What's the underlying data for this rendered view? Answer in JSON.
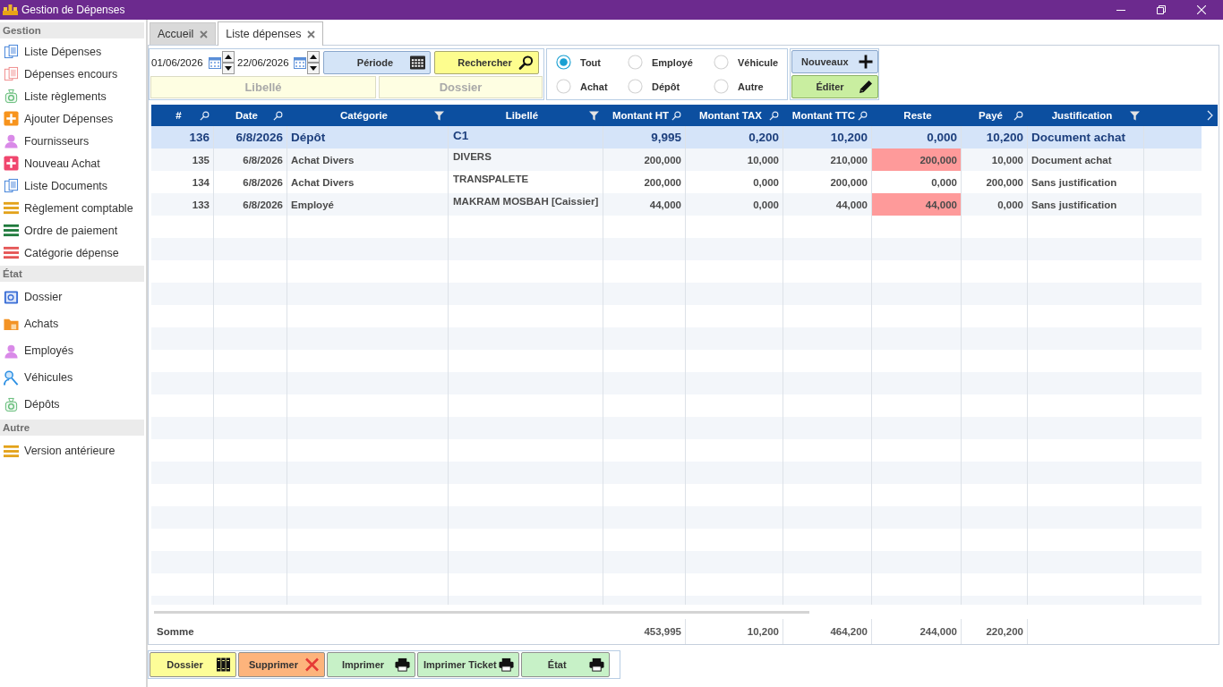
{
  "window": {
    "title": "Gestion de Dépenses"
  },
  "sidebar": {
    "sections": [
      {
        "title": "Gestion",
        "items": [
          {
            "label": "Liste Dépenses"
          },
          {
            "label": "Dépenses encours"
          },
          {
            "label": "Liste règlements"
          },
          {
            "label": "Ajouter Dépenses"
          },
          {
            "label": "Fournisseurs"
          },
          {
            "label": "Nouveau Achat"
          },
          {
            "label": "Liste Documents"
          },
          {
            "label": "Règlement comptable"
          },
          {
            "label": "Ordre de paiement"
          },
          {
            "label": "Catégorie dépense"
          }
        ]
      },
      {
        "title": "État",
        "items": [
          {
            "label": "Dossier"
          },
          {
            "label": "Achats"
          },
          {
            "label": "Employés"
          },
          {
            "label": "Véhicules"
          },
          {
            "label": "Dépôts"
          }
        ]
      },
      {
        "title": "Autre",
        "items": [
          {
            "label": "Version antérieure"
          }
        ]
      }
    ]
  },
  "tabs": [
    {
      "label": "Accueil",
      "selected": false
    },
    {
      "label": "Liste dépenses",
      "selected": true
    }
  ],
  "filters": {
    "date_from": "01/06/2026",
    "date_to": "22/06/2026",
    "period_button": "Période",
    "search_button": "Rechercher",
    "libelle_field": {
      "placeholder": "Libellé"
    },
    "dossier_field": {
      "placeholder": "Dossier"
    }
  },
  "type_filter": [
    {
      "label": "Tout",
      "selected": true
    },
    {
      "label": "Employé",
      "selected": false
    },
    {
      "label": "Véhicule",
      "selected": false
    },
    {
      "label": "Achat",
      "selected": false
    },
    {
      "label": "Dépôt",
      "selected": false
    },
    {
      "label": "Autre",
      "selected": false
    }
  ],
  "actions": {
    "new_button": "Nouveaux",
    "edit_button": "Éditer"
  },
  "table": {
    "columns": [
      {
        "label": "#",
        "kind": "search"
      },
      {
        "label": "Date",
        "kind": "search"
      },
      {
        "label": "Catégorie",
        "kind": "filter"
      },
      {
        "label": "Libellé",
        "kind": "filter"
      },
      {
        "label": "Montant HT",
        "kind": "search"
      },
      {
        "label": "Montant TAX",
        "kind": "search"
      },
      {
        "label": "Montant TTC",
        "kind": "search"
      },
      {
        "label": "Reste",
        "kind": "plain"
      },
      {
        "label": "Payé",
        "kind": "search"
      },
      {
        "label": "Justification",
        "kind": "filter"
      }
    ],
    "rows": [
      {
        "number": "136",
        "date": "6/8/2026",
        "categorie": "Dépôt",
        "libelle": "C1",
        "montant_ht": "9,995",
        "montant_tax": "0,200",
        "montant_ttc": "10,200",
        "reste": "0,000",
        "paye": "10,200",
        "justification": "Document achat",
        "selected": true,
        "reste_flagged": false
      },
      {
        "number": "135",
        "date": "6/8/2026",
        "categorie": "Achat Divers",
        "libelle": "DIVERS",
        "montant_ht": "200,000",
        "montant_tax": "10,000",
        "montant_ttc": "210,000",
        "reste": "200,000",
        "paye": "10,000",
        "justification": "Document achat",
        "selected": false,
        "reste_flagged": true
      },
      {
        "number": "134",
        "date": "6/8/2026",
        "categorie": "Achat Divers",
        "libelle": "TRANSPALETE",
        "montant_ht": "200,000",
        "montant_tax": "0,000",
        "montant_ttc": "200,000",
        "reste": "0,000",
        "paye": "200,000",
        "justification": "Sans justification",
        "selected": false,
        "reste_flagged": false
      },
      {
        "number": "133",
        "date": "6/8/2026",
        "categorie": "Employé",
        "libelle": "MAKRAM MOSBAH [Caissier]",
        "montant_ht": "44,000",
        "montant_tax": "0,000",
        "montant_ttc": "44,000",
        "reste": "44,000",
        "paye": "0,000",
        "justification": "Sans justification",
        "selected": false,
        "reste_flagged": true
      }
    ],
    "totals": {
      "label": "Somme",
      "montant_ht": "453,995",
      "montant_tax": "10,200",
      "montant_ttc": "464,200",
      "reste": "244,000",
      "paye": "220,200"
    }
  },
  "bottom_buttons": [
    {
      "label": "Dossier",
      "kind": "dossier"
    },
    {
      "label": "Supprimer",
      "kind": "delete"
    },
    {
      "label": "Imprimer",
      "kind": "print"
    },
    {
      "label": "Imprimer Ticket",
      "kind": "print"
    },
    {
      "label": "État",
      "kind": "print"
    }
  ]
}
